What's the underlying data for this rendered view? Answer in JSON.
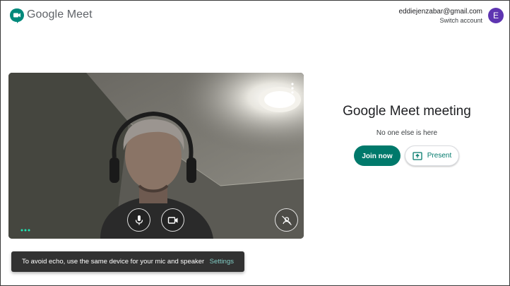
{
  "header": {
    "brand": "Google Meet",
    "account_email": "eddiejenzabar@gmail.com",
    "switch_account": "Switch account",
    "avatar_initial": "E"
  },
  "video": {
    "controls": [
      "mic-icon",
      "camera-icon",
      "visual-effects-icon"
    ]
  },
  "meeting": {
    "title": "Google Meet meeting",
    "status": "No one else is here",
    "join_label": "Join now",
    "present_label": "Present"
  },
  "toast": {
    "message": "To avoid echo, use the same device for your mic and speaker",
    "action": "Settings"
  },
  "colors": {
    "accent": "#00796b",
    "avatar": "#5e35b1",
    "toast_bg": "#323232"
  }
}
